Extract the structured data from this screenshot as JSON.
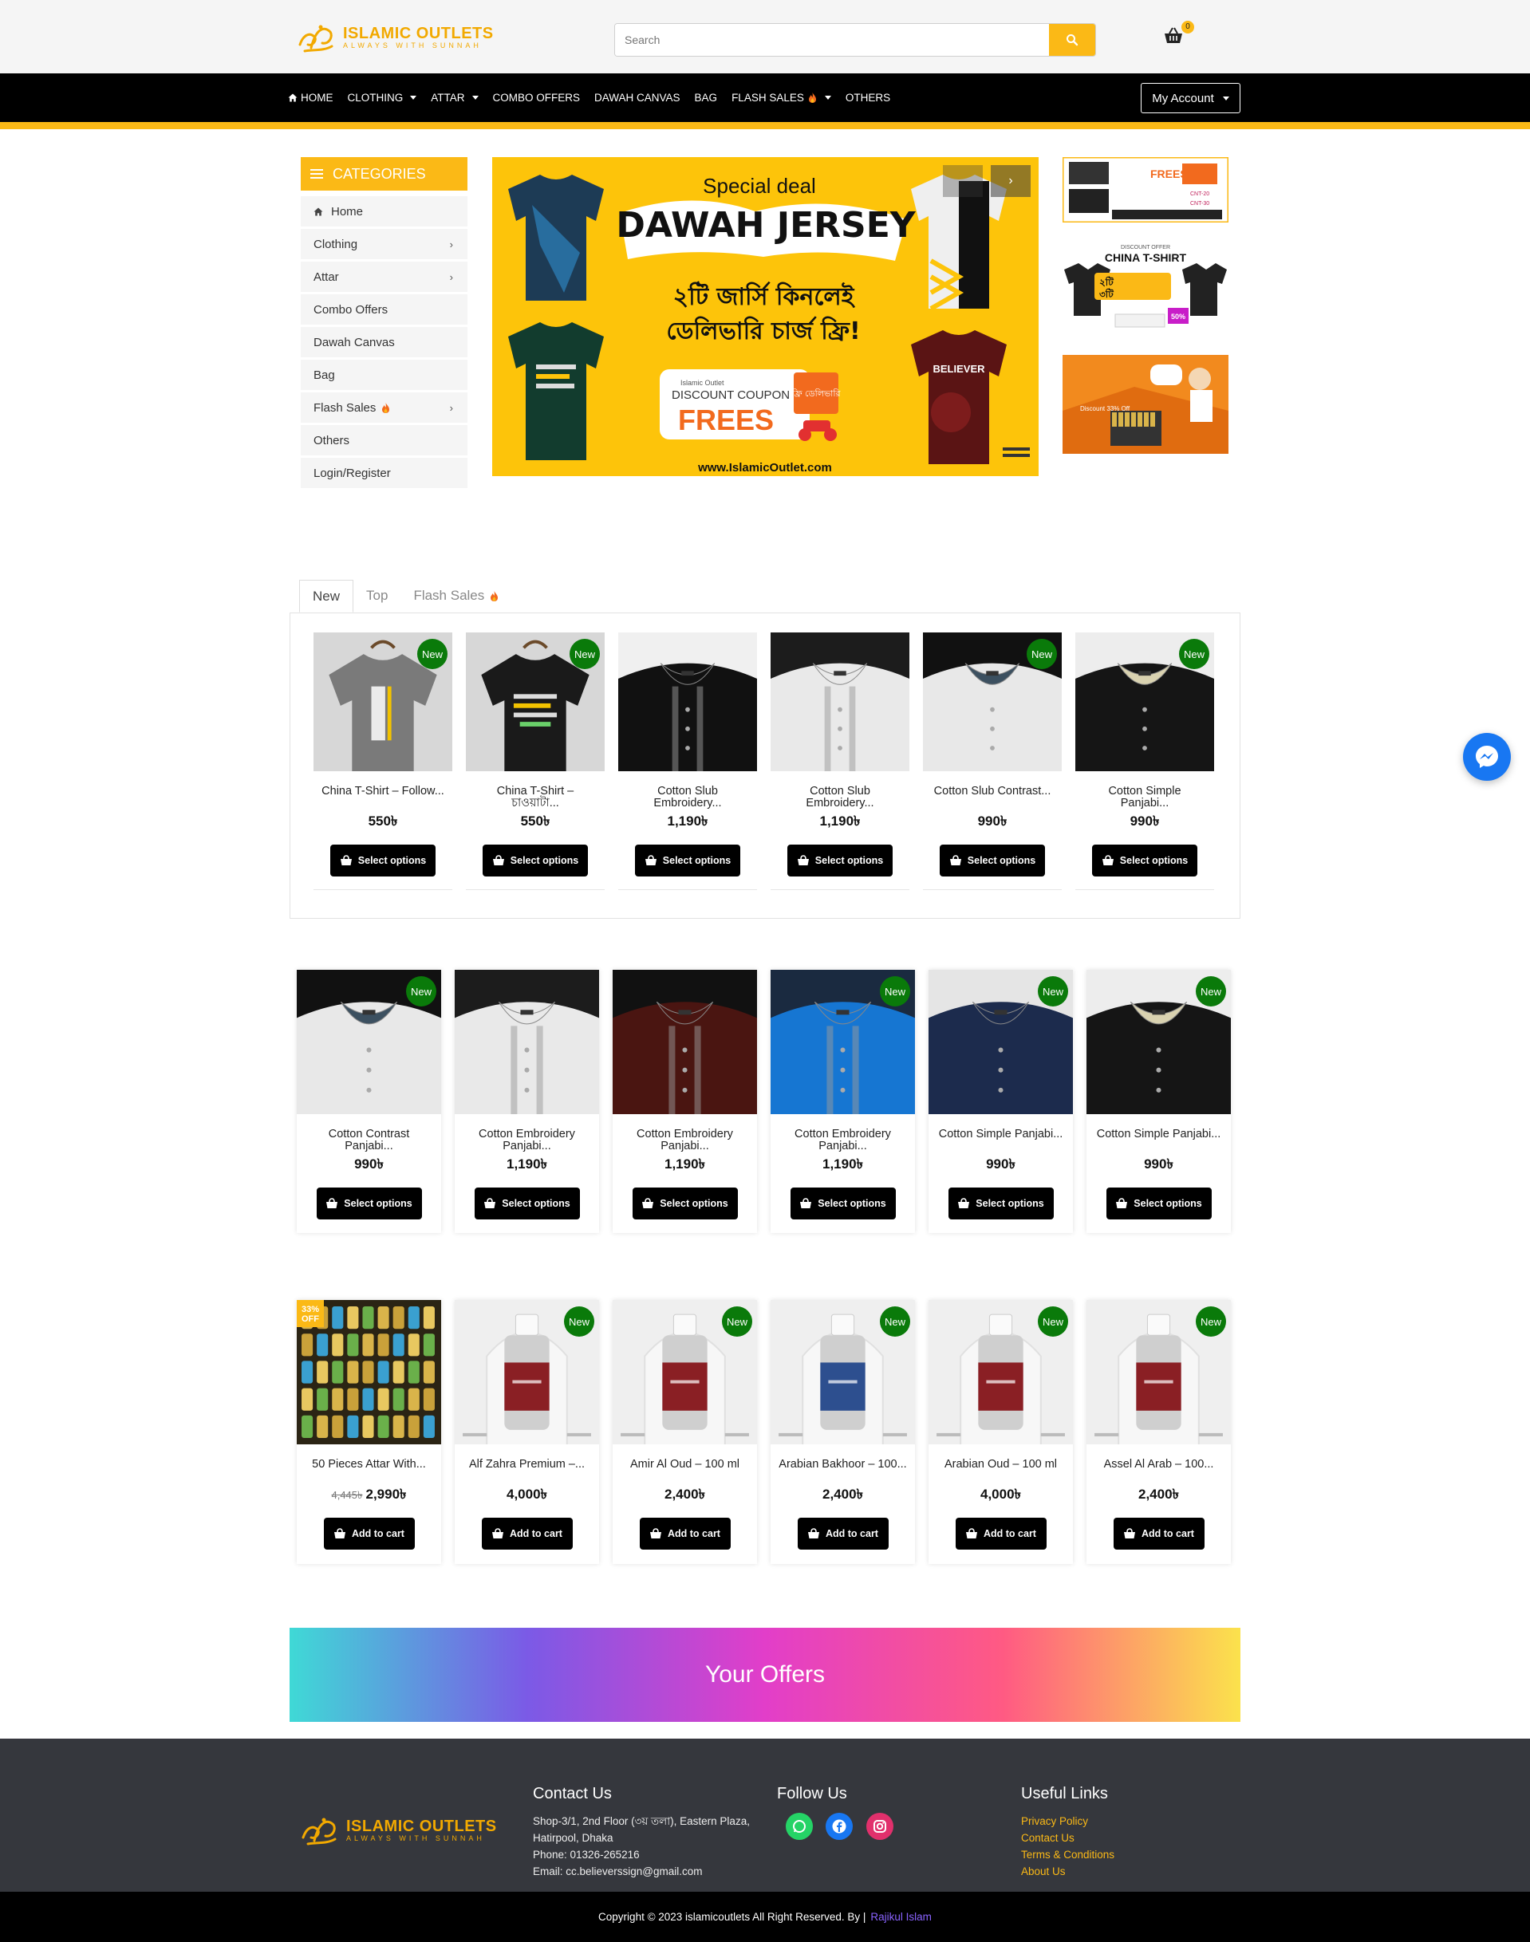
{
  "header": {
    "logo_title": "ISLAMIC OUTLETS",
    "logo_tagline": "ALWAYS WITH SUNNAH",
    "search_placeholder": "Search",
    "cart_count": "0",
    "account_label": "My Account",
    "accent": "#fbb916"
  },
  "nav": [
    {
      "label": "HOME",
      "icon": "home-icon"
    },
    {
      "label": "CLOTHING",
      "dropdown": true
    },
    {
      "label": "ATTAR",
      "dropdown": true
    },
    {
      "label": "COMBO OFFERS"
    },
    {
      "label": "DAWAH CANVAS"
    },
    {
      "label": "BAG"
    },
    {
      "label": "FLASH SALES",
      "dropdown": true,
      "icon": "fire-icon"
    },
    {
      "label": "OTHERS"
    }
  ],
  "categories": {
    "title": "CATEGORIES",
    "items": [
      {
        "label": "Home",
        "icon": "home-icon"
      },
      {
        "label": "Clothing",
        "arrow": true
      },
      {
        "label": "Attar",
        "arrow": true
      },
      {
        "label": "Combo Offers"
      },
      {
        "label": "Dawah Canvas"
      },
      {
        "label": "Bag"
      },
      {
        "label": "Flash Sales",
        "arrow": true,
        "icon": "fire-icon"
      },
      {
        "label": "Others"
      },
      {
        "label": "Login/Register"
      }
    ]
  },
  "banner": {
    "line1": "Special deal",
    "line2": "DAWAH JERSEY",
    "bn_line1": "২টি জার্সি কিনলেই",
    "bn_line2": "ডেলিভারি চার্জ ফ্রি!",
    "coupon_brand": "Islamic Outlet",
    "coupon_label": "DISCOUNT COUPON",
    "coupon_code": "FREES",
    "coupon_badge": "ফ্রি ডেলিভারি",
    "shirt_text": "BELIEVER",
    "url": "www.IslamicOutlet.com"
  },
  "side_ads": {
    "ad1_title": "FREES",
    "ad1_code1": "CNT-20",
    "ad1_code2": "CNT-30",
    "ad2_label": "DISCOUNT OFFER",
    "ad2_title": "CHINA T-SHIRT",
    "ad2_line1": "২টি",
    "ad2_line2": "৩টি",
    "ad2_pct": "50%",
    "ad3_label": "Discount 33% Off"
  },
  "tabs": [
    {
      "label": "New",
      "active": true
    },
    {
      "label": "Top"
    },
    {
      "label": "Flash Sales",
      "icon": "fire-icon"
    }
  ],
  "tab_products": [
    {
      "name": "China T-Shirt – Follow...",
      "price": "550৳",
      "button": "Select options",
      "badge": "New",
      "img": "tshirt-grey"
    },
    {
      "name": "China T-Shirt – চাওয়াটা...",
      "price": "550৳",
      "button": "Select options",
      "badge": "New",
      "img": "tshirt-black"
    },
    {
      "name": "Cotton Slub Embroidery...",
      "price": "1,190৳",
      "button": "Select options",
      "badge": "",
      "img": "panjabi-black"
    },
    {
      "name": "Cotton Slub Embroidery...",
      "price": "1,190৳",
      "button": "Select options",
      "badge": "",
      "img": "panjabi-white"
    },
    {
      "name": "Cotton Slub Contrast...",
      "price": "990৳",
      "button": "Select options",
      "badge": "New",
      "img": "panjabi-contrast"
    },
    {
      "name": "Cotton Simple Panjabi...",
      "price": "990৳",
      "button": "Select options",
      "badge": "New",
      "img": "panjabi-black2"
    }
  ],
  "panjabi_products": [
    {
      "name": "Cotton Contrast Panjabi...",
      "price": "990৳",
      "button": "Select options",
      "badge": "New",
      "img": "panjabi-contrast"
    },
    {
      "name": "Cotton Embroidery Panjabi...",
      "price": "1,190৳",
      "button": "Select options",
      "badge": "",
      "img": "panjabi-white"
    },
    {
      "name": "Cotton Embroidery Panjabi...",
      "price": "1,190৳",
      "button": "Select options",
      "badge": "",
      "img": "panjabi-maroon"
    },
    {
      "name": "Cotton Embroidery Panjabi...",
      "price": "1,190৳",
      "button": "Select options",
      "badge": "New",
      "img": "panjabi-blue"
    },
    {
      "name": "Cotton Simple Panjabi...",
      "price": "990৳",
      "button": "Select options",
      "badge": "New",
      "img": "panjabi-navy"
    },
    {
      "name": "Cotton Simple Panjabi...",
      "price": "990৳",
      "button": "Select options",
      "badge": "New",
      "img": "panjabi-black2"
    }
  ],
  "attar_products": [
    {
      "name": "50 Pieces Attar With...",
      "old_price": "4,445৳",
      "price": "2,990৳",
      "button": "Add to cart",
      "badge": "",
      "sale": "33% OFF",
      "img": "attar-box"
    },
    {
      "name": "Alf Zahra Premium –...",
      "price": "4,000৳",
      "button": "Add to cart",
      "badge": "New",
      "img": "bottle-red"
    },
    {
      "name": "Amir Al Oud – 100 ml",
      "price": "2,400৳",
      "button": "Add to cart",
      "badge": "New",
      "img": "bottle-red"
    },
    {
      "name": "Arabian Bakhoor – 100...",
      "price": "2,400৳",
      "button": "Add to cart",
      "badge": "New",
      "img": "bottle-blue"
    },
    {
      "name": "Arabian Oud – 100 ml",
      "price": "4,000৳",
      "button": "Add to cart",
      "badge": "New",
      "img": "bottle-red"
    },
    {
      "name": "Assel Al Arab – 100...",
      "price": "2,400৳",
      "button": "Add to cart",
      "badge": "New",
      "img": "bottle-red"
    }
  ],
  "offers": {
    "title": "Your Offers"
  },
  "footer": {
    "contact_title": "Contact Us",
    "address": "Shop-3/1, 2nd Floor (৩য় তলা), Eastern Plaza, Hatirpool, Dhaka",
    "phone": "Phone: 01326-265216",
    "email": "Email: cc.believerssign@gmail.com",
    "follow_title": "Follow Us",
    "social": [
      "whatsapp-icon",
      "facebook-icon",
      "instagram-icon"
    ],
    "links_title": "Useful Links",
    "links": [
      "Privacy Policy",
      "Contact Us",
      "Terms & Conditions",
      "About Us"
    ],
    "copyright": "Copyright © 2023 islamicoutlets All Right Reserved. By |",
    "author": "Rajikul Islam"
  }
}
